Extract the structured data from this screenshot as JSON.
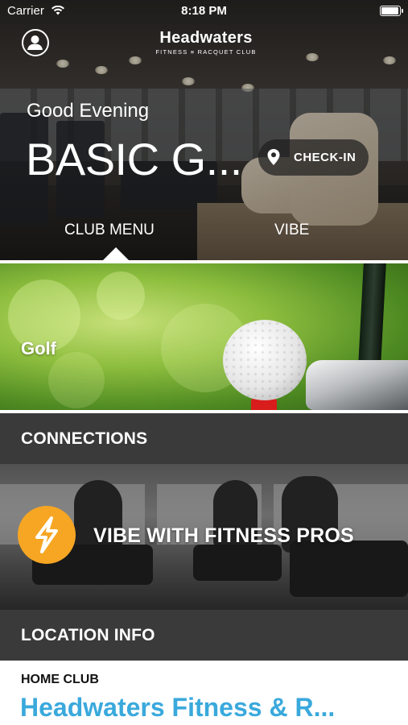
{
  "status_bar": {
    "carrier": "Carrier",
    "time": "8:18 PM",
    "battery_level": 1.0
  },
  "header": {
    "logo_title": "Headwaters",
    "logo_subtitle": "FITNESS ≡ RACQUET CLUB",
    "profile_icon": "user-circle-icon"
  },
  "hero": {
    "greeting": "Good Evening",
    "member_name": "BASIC G...",
    "checkin_label": "CHECK-IN",
    "checkin_icon": "map-pin-icon"
  },
  "tabs": [
    {
      "label": "CLUB MENU",
      "selected": true
    },
    {
      "label": "VIBE",
      "selected": false
    }
  ],
  "golf_card": {
    "title": "Golf"
  },
  "connections": {
    "header": "CONNECTIONS",
    "vibe_card_title": "VIBE WITH FITNESS PROS",
    "vibe_icon": "lightning-bolt-icon",
    "accent_color": "#f6a623"
  },
  "location": {
    "header": "LOCATION INFO",
    "home_club_label": "HOME CLUB",
    "home_club_name": "Headwaters Fitness & R...",
    "link_color": "#3aa9dc"
  }
}
